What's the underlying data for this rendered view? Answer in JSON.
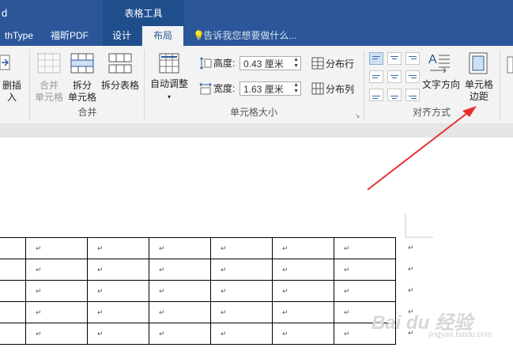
{
  "title_bar": {
    "app_fragment": "d",
    "context_title": "表格工具"
  },
  "tabs": [
    {
      "label": "thType"
    },
    {
      "label": "福昕PDF"
    },
    {
      "label": "设计"
    },
    {
      "label": "布局"
    }
  ],
  "tell_me": "告诉我您想要做什么...",
  "ribbon": {
    "rows_cols": {
      "insert_label": "删插入"
    },
    "merge": {
      "group_label": "合并",
      "merge_cells": "合并\n单元格",
      "split_cells": "拆分\n单元格",
      "split_table": "拆分表格"
    },
    "cell_size": {
      "group_label": "单元格大小",
      "autofit": "自动调整",
      "height_label": "高度:",
      "height_value": "0.43 厘米",
      "width_label": "宽度:",
      "width_value": "1.63 厘米",
      "distribute_rows": "分布行",
      "distribute_cols": "分布列"
    },
    "alignment": {
      "group_label": "对齐方式",
      "text_direction": "文字方向",
      "cell_margins": "单元格\n边距"
    }
  },
  "document": {
    "cell_mark": "↵",
    "row_count": 5,
    "col_count": 7
  },
  "watermark": {
    "main": "Bai du 经验",
    "sub": "jingyan.baidu.com"
  },
  "colors": {
    "title_bar": "#2b579a",
    "context_tab": "#1e4e8c",
    "arrow": "#e8302a"
  }
}
